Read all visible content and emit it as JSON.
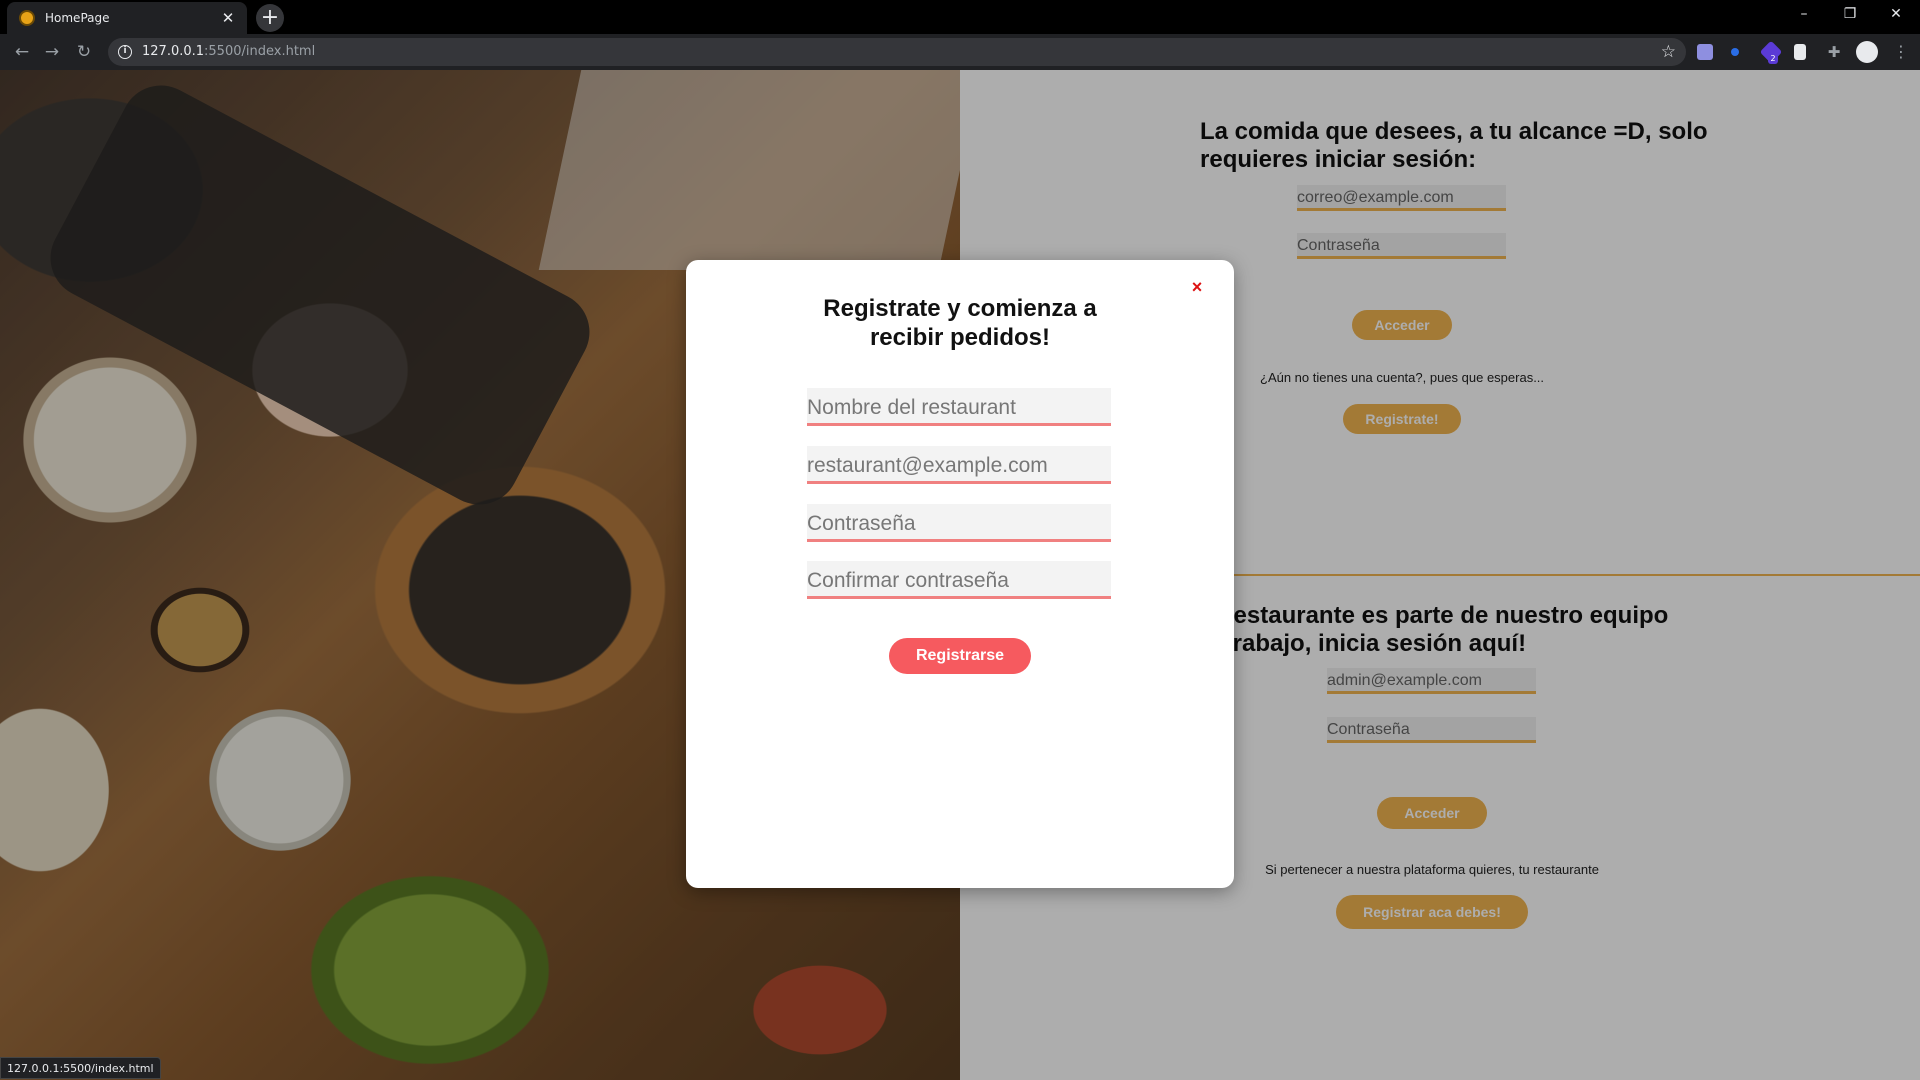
{
  "browser": {
    "tab_title": "HomePage",
    "tab_close": "✕",
    "new_tab": "+",
    "url_host": "127.0.0.1",
    "url_path": ":5500/index.html",
    "status_url": "127.0.0.1:5500/index.html",
    "window_minimize": "–",
    "window_restore": "❐",
    "window_close": "✕",
    "extension_badge": "2"
  },
  "user_login": {
    "title_line1": "La comida que desees, a tu alcance =D, solo",
    "title_line2": "requieres iniciar sesión:",
    "email_placeholder": "correo@example.com",
    "password_placeholder": "Contraseña",
    "login_label": "Acceder",
    "signup_prompt": "¿Aún no tienes una cuenta?, pues que esperas...",
    "signup_label": "Registrate!"
  },
  "restaurant_login": {
    "title_line1": "Tu restaurante es parte de nuestro equipo",
    "title_line2": "de trabajo, inicia sesión aquí!",
    "email_placeholder": "admin@example.com",
    "password_placeholder": "Contraseña",
    "login_label": "Acceder",
    "register_prompt": "Si pertenecer a nuestra plataforma quieres, tu restaurante",
    "register_label": "Registrar aca debes!"
  },
  "modal": {
    "close_label": "×",
    "title_line1": "Registrate y comienza a",
    "title_line2": "recibir pedidos!",
    "name_placeholder": "Nombre del restaurant",
    "email_placeholder": "restaurant@example.com",
    "password_placeholder": "Contraseña",
    "confirm_placeholder": "Confirmar contraseña",
    "submit_label": "Registrarse"
  },
  "colors": {
    "accent": "#f1b450",
    "modal_accent": "#f65a5f",
    "close": "#dd1111"
  }
}
